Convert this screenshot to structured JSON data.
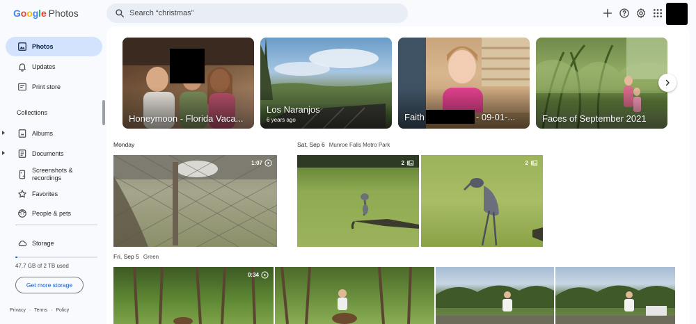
{
  "header": {
    "logo_google": "Google",
    "logo_photos": "Photos",
    "search_placeholder": "Search “christmas”"
  },
  "sidebar": {
    "items": [
      {
        "label": "Photos",
        "icon": "photo-icon",
        "active": true
      },
      {
        "label": "Updates",
        "icon": "bell-icon"
      },
      {
        "label": "Print store",
        "icon": "print-store-icon"
      }
    ],
    "collections_title": "Collections",
    "collections": [
      {
        "label": "Albums",
        "icon": "album-icon",
        "expandable": true
      },
      {
        "label": "Documents",
        "icon": "document-icon",
        "expandable": true
      },
      {
        "label": "Screenshots & recordings",
        "icon": "screenshot-icon"
      },
      {
        "label": "Favorites",
        "icon": "star-icon"
      },
      {
        "label": "People & pets",
        "icon": "face-icon"
      }
    ],
    "storage_label": "Storage",
    "storage_used": "47.7 GB of 2 TB used",
    "storage_fraction": 0.024,
    "get_storage_label": "Get more storage",
    "footer": {
      "privacy": "Privacy",
      "terms": "Terms",
      "policy": "Policy",
      "sep": "·"
    }
  },
  "memories": [
    {
      "title": "Honeymoon - Florida Vaca...",
      "subtitle": ""
    },
    {
      "title": "Los Naranjos",
      "subtitle": "6 years ago"
    },
    {
      "title": "Faith",
      "title_suffix": "- 09-01-...",
      "subtitle": ""
    },
    {
      "title": "Faces of September 2021",
      "subtitle": ""
    }
  ],
  "groups": [
    {
      "date": "Monday",
      "location": ""
    },
    {
      "date": "Sat, Sep 6",
      "location": "Munroe Falls Metro Park"
    },
    {
      "date": "Fri, Sep 5",
      "location": "Green"
    }
  ],
  "thumbs": {
    "video1_duration": "1:07",
    "heron1_count": "2",
    "heron2_count": "2",
    "video2_duration": "0:34"
  },
  "colors": {
    "accent": "#0b57d0",
    "active_nav": "#d3e3fd",
    "search_bg": "#e9eef6"
  }
}
